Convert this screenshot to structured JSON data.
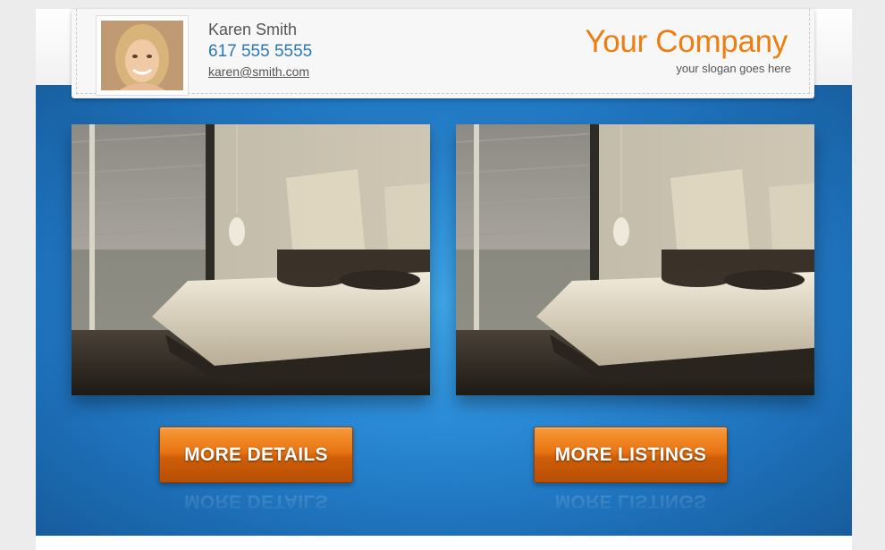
{
  "agent": {
    "name": "Karen Smith",
    "phone": "617 555 5555",
    "email": "karen@smith.com"
  },
  "company": {
    "name": "Your Company",
    "slogan": "your slogan goes here"
  },
  "buttons": {
    "details_label": "MORE DETAILS",
    "listings_label": "MORE LISTINGS"
  },
  "colors": {
    "brand_orange": "#ef7d10",
    "phone_blue": "#2a78b6",
    "hero_blue": "#2a8ad6",
    "button_orange": "#e87412"
  },
  "images": {
    "avatar": "avatar-photo",
    "listing_left": "bedroom-photo",
    "listing_right": "bedroom-photo"
  }
}
